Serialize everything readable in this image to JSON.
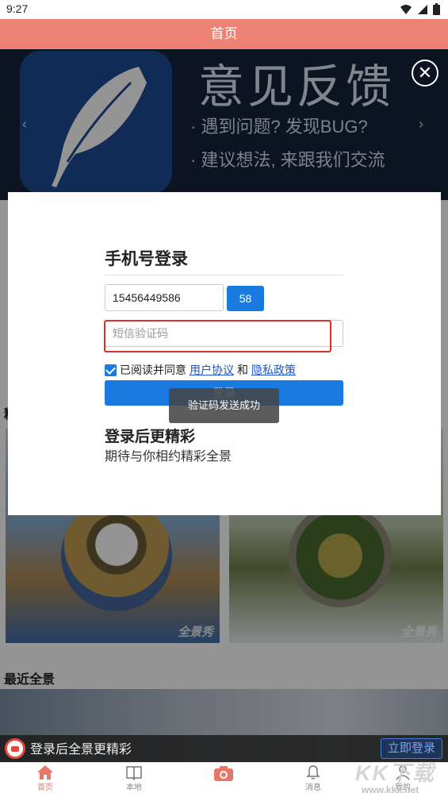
{
  "status_bar": {
    "time": "9:27"
  },
  "header": {
    "title": "首页"
  },
  "banner": {
    "title": "意见反馈",
    "lines": [
      "· 遇到问题? 发现BUG?",
      "· 建议想法, 来跟我们交流"
    ],
    "prev_glyph": "‹",
    "next_glyph": "›",
    "close_glyph": "✕"
  },
  "sections": {
    "featured_label": "精",
    "recent_label": "最近全景"
  },
  "pano_cards": [
    {
      "watermark": "全景秀"
    },
    {
      "watermark": "全景秀"
    }
  ],
  "modal": {
    "title": "手机号登录",
    "phone_value": "15456449586",
    "countdown": "58",
    "code_placeholder": "短信验证码",
    "agree_text": "已阅读并同意",
    "agree_link1": "用户协议",
    "agree_and": "和",
    "agree_link2": "隐私政策",
    "login_button": "登录",
    "toast": "验证码发送成功",
    "promo_title": "登录后更精彩",
    "promo_sub": "期待与你相约精彩全景"
  },
  "login_bar": {
    "text": "登录后全景更精彩",
    "button": "立即登录"
  },
  "tabbar": {
    "items": [
      {
        "label": "首页",
        "icon": "home-icon",
        "active": true
      },
      {
        "label": "本地",
        "icon": "book-icon",
        "active": false
      },
      {
        "label": "",
        "icon": "camera-icon",
        "active": false
      },
      {
        "label": "消息",
        "icon": "bell-icon",
        "active": false
      },
      {
        "label": "我的",
        "icon": "user-icon",
        "active": false
      }
    ]
  },
  "watermark": {
    "logo": "KK下载",
    "url": "www.kkx.net"
  },
  "colors": {
    "header": "#ee8275",
    "primary": "#1a7ae0",
    "highlight": "#d9302a",
    "active_tab": "#e9766a"
  }
}
